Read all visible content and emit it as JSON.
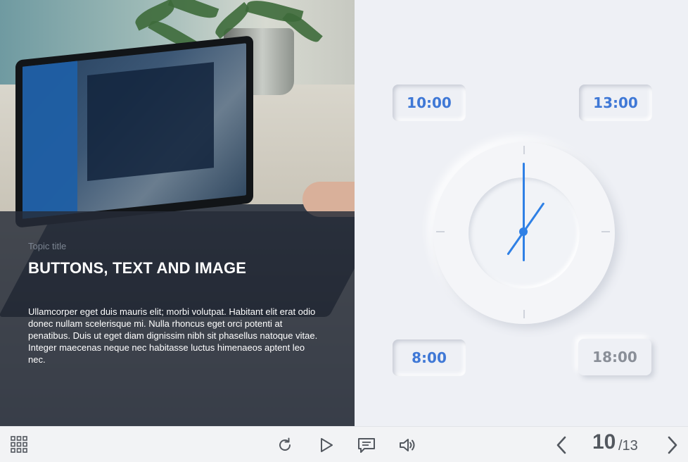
{
  "lesson": {
    "topic_label": "Topic title",
    "title": "BUTTONS, TEXT AND IMAGE",
    "body": "Ullamcorper eget duis mauris elit; morbi volutpat. Habitant elit erat odio donec nullam scelerisque mi. Nulla rhoncus eget orci potenti at penatibus. Duis ut eget diam dignissim nibh sit phasellus natoque vitae. Integer maecenas neque nec habitasse luctus himenaeos aptent leo nec."
  },
  "times": {
    "t1000": "10:00",
    "t1300": "13:00",
    "t0800": "8:00",
    "t1800": "18:00"
  },
  "colors": {
    "accent": "#3f78d6",
    "clock_hand": "#2f80e5",
    "muted": "#8a8f98"
  },
  "toolbar": {
    "menu_icon": "grid-icon",
    "replay_icon": "replay-icon",
    "play_icon": "play-icon",
    "comment_icon": "comment-icon",
    "volume_icon": "volume-icon",
    "prev_icon": "chevron-left-icon",
    "next_icon": "chevron-right-icon"
  },
  "pagination": {
    "current": "10",
    "total": "/13"
  }
}
